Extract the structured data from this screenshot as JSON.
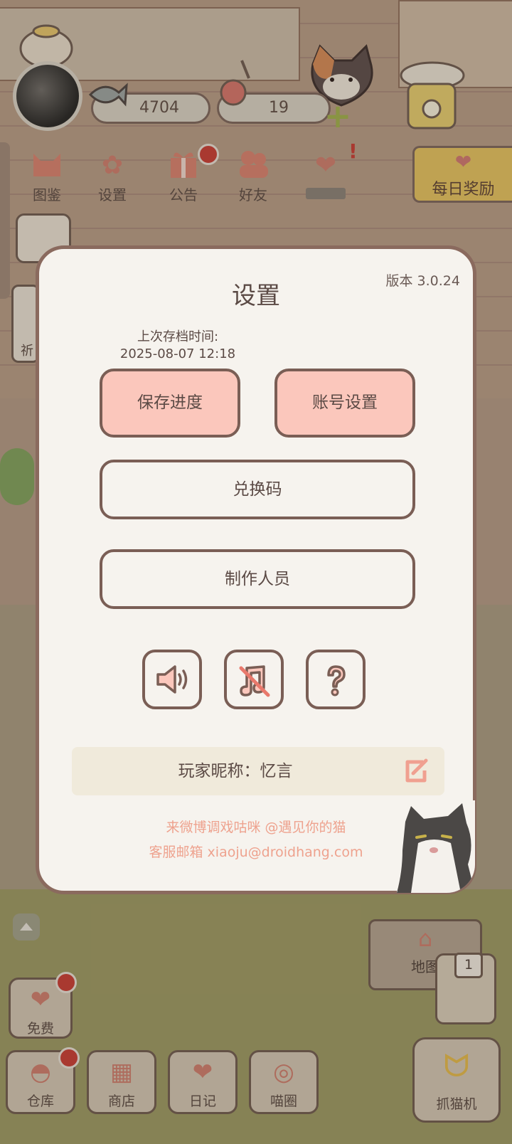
{
  "top_bar": {
    "fish_count": "4704",
    "heart_count": "19",
    "buttons": [
      {
        "label": "图鉴"
      },
      {
        "label": "设置"
      },
      {
        "label": "公告"
      },
      {
        "label": "好友"
      },
      {
        "label": ""
      }
    ],
    "daily_reward": "每日奖励"
  },
  "side": {
    "partial_label": "祈"
  },
  "bottom_bar": {
    "free": "免费",
    "buttons": [
      {
        "label": "仓库"
      },
      {
        "label": "商店"
      },
      {
        "label": "日记"
      },
      {
        "label": "喵圈"
      }
    ],
    "map": "地图",
    "map_badge": "1",
    "claw_machine": "抓猫机"
  },
  "settings": {
    "title": "设置",
    "version": "版本 3.0.24",
    "last_save_label": "上次存档时间:",
    "last_save_time": "2025-08-07 12:18",
    "save_progress": "保存进度",
    "account_settings": "账号设置",
    "redeem_code": "兑换码",
    "credits": "制作人员",
    "nickname_label": "玩家昵称：忆言",
    "weibo_line": "来微博调戏咕咪 @遇见你的猫",
    "email_line": "客服邮箱 xiaoju@droidhang.com"
  },
  "colors": {
    "modal_bg": "#f6f3ee",
    "border": "#7a5e55",
    "pink_button": "#fbc7bc",
    "footer_text": "#eea28e",
    "badge_red": "#c83b33"
  },
  "icons": [
    "sound-on-icon",
    "music-off-icon",
    "help-icon",
    "edit-icon"
  ]
}
